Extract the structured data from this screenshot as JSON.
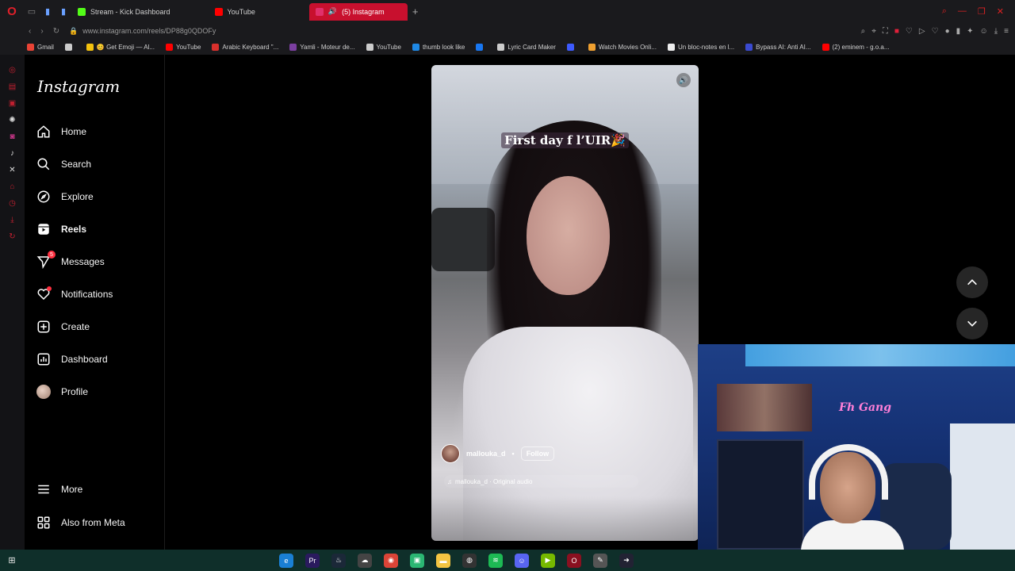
{
  "browser": {
    "tabs": [
      {
        "label": "Stream - Kick Dashboard",
        "color": "#53fc18"
      },
      {
        "label": "YouTube",
        "color": "#ff0000"
      },
      {
        "label": "(5) Instagram",
        "color": "#e1306c",
        "active": true
      }
    ],
    "url": "www.instagram.com/reels/DP88g0QDOFy",
    "bookmarks": [
      {
        "label": "Gmail",
        "color": "#ea4335"
      },
      {
        "label": "",
        "color": "#cccccc"
      },
      {
        "label": "😊 Get Emoji — Al...",
        "color": "#f4c20d"
      },
      {
        "label": "YouTube",
        "color": "#ff0000"
      },
      {
        "label": "Arabic Keyboard \"...",
        "color": "#d9302c"
      },
      {
        "label": "Yamli - Moteur de...",
        "color": "#7b3fa0"
      },
      {
        "label": "YouTube",
        "color": "#cccccc"
      },
      {
        "label": "thumb look like",
        "color": "#1e88e5"
      },
      {
        "label": "",
        "color": "#1877f2"
      },
      {
        "label": "Lyric Card Maker",
        "color": "#cccccc"
      },
      {
        "label": "",
        "color": "#3d5afe"
      },
      {
        "label": "Watch Movies Onli...",
        "color": "#f0a030"
      },
      {
        "label": "Un bloc-notes en l...",
        "color": "#eeeeee"
      },
      {
        "label": "Bypass AI: Anti AI...",
        "color": "#3a4ad0"
      },
      {
        "label": "(2) eminem - g.o.a...",
        "color": "#ff0000"
      }
    ]
  },
  "instagram": {
    "logo": "Instagram",
    "nav": [
      {
        "label": "Home",
        "icon": "home-icon"
      },
      {
        "label": "Search",
        "icon": "search-icon"
      },
      {
        "label": "Explore",
        "icon": "explore-icon"
      },
      {
        "label": "Reels",
        "icon": "reels-icon",
        "bold": true
      },
      {
        "label": "Messages",
        "icon": "messages-icon",
        "badge": "5"
      },
      {
        "label": "Notifications",
        "icon": "heart-icon",
        "dot": true
      },
      {
        "label": "Create",
        "icon": "plus-square-icon"
      },
      {
        "label": "Dashboard",
        "icon": "dashboard-icon"
      },
      {
        "label": "Profile",
        "icon": "avatar"
      }
    ],
    "more": "More",
    "also_from_meta": "Also from Meta"
  },
  "reel": {
    "caption": "First day f l’UIR🎉",
    "username": "mallouka_d",
    "separator": "•",
    "follow": "Follow",
    "audio": "mallouka_d · Original audio"
  }
}
